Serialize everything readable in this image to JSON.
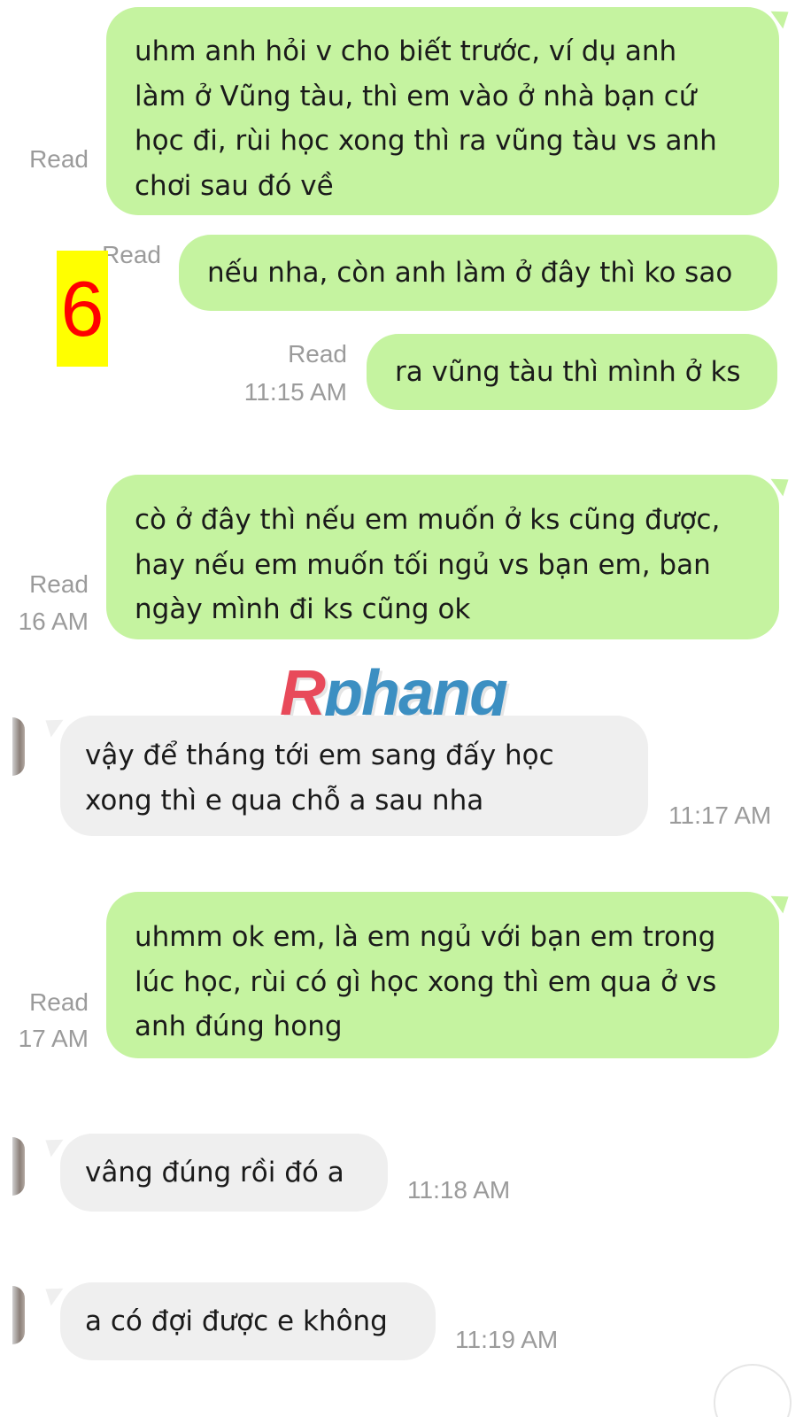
{
  "badge": "6",
  "watermark": {
    "letter": "R",
    "rest": "phang"
  },
  "messages": [
    {
      "lines": [
        "uhm anh hỏi v cho biết trước, ví dụ anh",
        "làm ở Vũng tàu, thì em vào ở nhà bạn cứ",
        "học đi, rùi học xong thì ra vũng tàu vs anh",
        "chơi sau đó về"
      ],
      "read": "Read"
    },
    {
      "lines": [
        "nếu nha, còn anh làm ở đây thì ko sao"
      ],
      "read": "Read"
    },
    {
      "lines": [
        "ra vũng tàu thì mình ở ks"
      ],
      "read": "Read",
      "time": "11:15 AM"
    },
    {
      "lines": [
        "cò ở đây thì nếu em muốn ở ks cũng được,",
        "hay nếu em muốn tối ngủ vs bạn em, ban",
        "ngày mình đi ks cũng ok"
      ],
      "read": "Read",
      "time": "16 AM"
    },
    {
      "lines": [
        "vậy để tháng tới em sang đấy học",
        "xong thì e qua chỗ a sau nha"
      ],
      "time": "11:17 AM"
    },
    {
      "lines": [
        "uhmm ok em, là em ngủ với bạn em trong",
        "lúc học, rùi có gì học xong thì em qua ở vs",
        "anh đúng hong"
      ],
      "read": "Read",
      "time": "17 AM"
    },
    {
      "lines": [
        "vâng đúng rồi đó a"
      ],
      "time": "11:18 AM"
    },
    {
      "lines": [
        "a có đợi được e không"
      ],
      "time": "11:19 AM"
    }
  ]
}
